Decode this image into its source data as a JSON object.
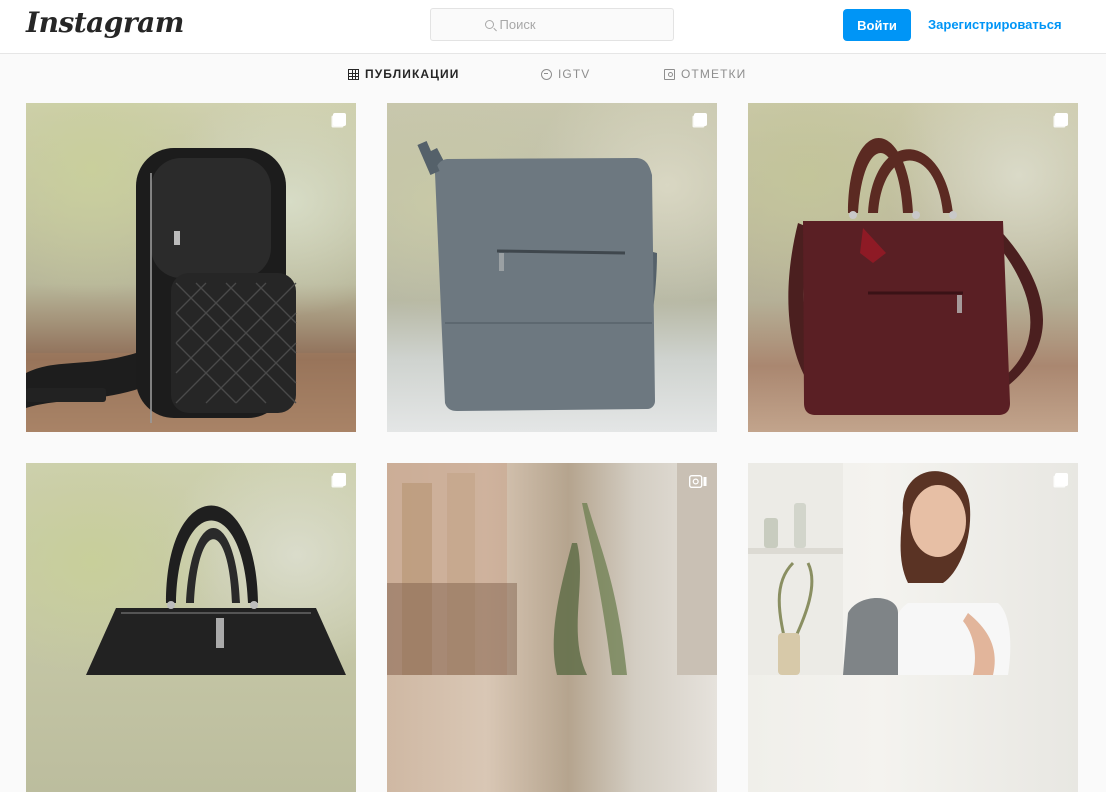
{
  "header": {
    "logo_text": "Instagram",
    "search_placeholder": "Поиск",
    "login_label": "Войти",
    "signup_label": "Зарегистрироваться"
  },
  "tabs": [
    {
      "label": "ПУБЛИКАЦИИ",
      "icon": "grid-icon",
      "active": true
    },
    {
      "label": "IGTV",
      "icon": "igtv-icon",
      "active": false
    },
    {
      "label": "ОТМЕТКИ",
      "icon": "tagged-icon",
      "active": false
    }
  ],
  "posts": [
    {
      "subject": "black leather backpack",
      "badge": "carousel-icon"
    },
    {
      "subject": "grey leather shoulder bag",
      "badge": "carousel-icon"
    },
    {
      "subject": "burgundy leather tote bag",
      "badge": "carousel-icon"
    },
    {
      "subject": "black leather handbag",
      "badge": "carousel-icon"
    },
    {
      "subject": "interior with plants",
      "badge": "video-icon"
    },
    {
      "subject": "woman with grey backpack",
      "badge": "carousel-icon"
    }
  ],
  "colors": {
    "accent": "#0095f6",
    "text_dark": "#262626",
    "text_muted": "#8e8e8e",
    "background": "#fafafa"
  }
}
